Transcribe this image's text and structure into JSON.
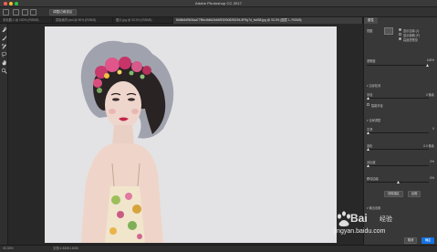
{
  "window": {
    "title": "Adobe Photoshop CC 2017"
  },
  "options_bar": {
    "button_label": "调整边缘选区"
  },
  "tabs": [
    {
      "label": "未标题-1 @ 100% (RGB/8)",
      "active": false
    },
    {
      "label": "蒙版素材.psd @ 50% (RGB/8)",
      "active": false
    },
    {
      "label": "图片.jpg @ 33.3% (RGB/8)",
      "active": false
    },
    {
      "label": "8fd5b8d9604aa77f5bc9d6d2b64f930f0082f5294-8FBy7d_fw658.jpg @ 33.3% (图层 1, RGB/8)",
      "active": true
    }
  ],
  "toolbar": {
    "icons": [
      "quick-selection-icon",
      "brush-icon",
      "refine-brush-icon",
      "lasso-icon",
      "hand-icon",
      "zoom-icon"
    ]
  },
  "properties": {
    "panel_title": "属性",
    "view_mode_label": "视图",
    "show_edge_label": "显示边缘 (J)",
    "show_original_label": "显示原稿 (P)",
    "high_quality_label": "高品质预览",
    "transparency_label": "透明度",
    "transparency_value": "100%",
    "edge_detection_section": "边缘检测",
    "radius_label": "半径",
    "radius_value": "0 像素",
    "smart_radius_label": "智能半径",
    "global_refine_section": "全局调整",
    "smooth_label": "平滑",
    "smooth_value": "0",
    "feather_label": "羽化",
    "feather_value": "0.0 像素",
    "contrast_label": "对比度",
    "contrast_value": "0%",
    "shift_edge_label": "移动边缘",
    "shift_edge_value": "0%",
    "clear_selection_button": "清除选区",
    "invert_button": "反相",
    "output_section": "输出设置",
    "cancel_button": "取消",
    "ok_button": "确定"
  },
  "status_bar": {
    "zoom": "33.33%",
    "doc_info": "文档:1.82M/1.82M"
  },
  "watermark": {
    "brand": "Bai",
    "brand2": "经验",
    "url": "jingyan.baidu.com"
  }
}
